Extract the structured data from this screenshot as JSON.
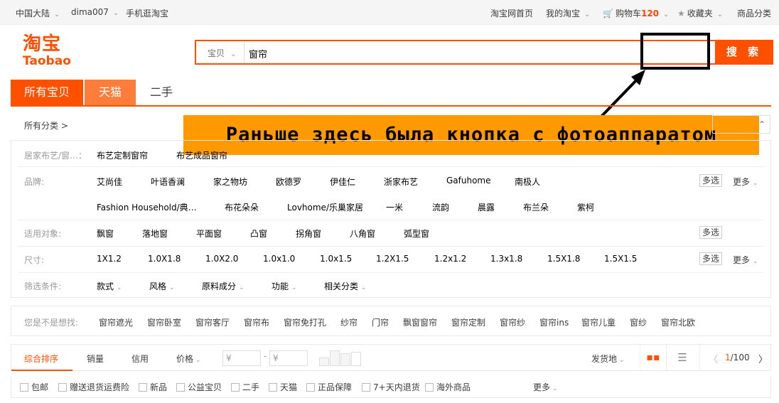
{
  "topbar": {
    "region": "中国大陆",
    "user": "dima007",
    "mobile": "手机逛淘宝",
    "home": "淘宝网首页",
    "my_taobao": "我的淘宝",
    "cart_label": "购物车",
    "cart_count": "120",
    "favorites": "收藏夹",
    "categories": "商品分类"
  },
  "logo": {
    "cn": "淘宝",
    "en": "Taobao"
  },
  "search": {
    "type": "宝贝",
    "query": "窗帘",
    "button": "搜 索"
  },
  "annotation": {
    "text": "Раньше здесь была кнопка с фотоаппаратом"
  },
  "tabs": {
    "all": "所有宝贝",
    "tmall": "天猫",
    "second": "二手"
  },
  "breadcrumb": {
    "all_categories": "所有分类 >"
  },
  "filters": {
    "category": {
      "label": "居家布艺/窗…：",
      "items": [
        "布艺定制窗帘",
        "布艺成品窗帘"
      ]
    },
    "brand": {
      "label": "品牌:",
      "row1": [
        "艾尚佳",
        "叶语香澜",
        "家之物坊",
        "欧德罗",
        "伊佳仁",
        "浙家布艺",
        "Gafuhome",
        "南极人"
      ],
      "row2": [
        "Fashion Household/典…",
        "布花朵朵",
        "Lovhome/乐巢家居",
        "一米",
        "流韵",
        "晨露",
        "布兰朵",
        "紫柯"
      ]
    },
    "target": {
      "label": "适用对象:",
      "items": [
        "飘窗",
        "落地窗",
        "平面窗",
        "凸窗",
        "拐角窗",
        "八角窗",
        "弧型窗"
      ]
    },
    "size": {
      "label": "尺寸:",
      "items": [
        "1X1.2",
        "1.0X1.8",
        "1.0X2.0",
        "1.0x1.0",
        "1.0x1.5",
        "1.2X1.5",
        "1.2x1.2",
        "1.3x1.8",
        "1.5X1.8",
        "1.5X1.5"
      ]
    },
    "conditions": {
      "label": "筛选条件:",
      "items": [
        "款式",
        "风格",
        "原料成分",
        "功能",
        "相关分类"
      ]
    },
    "multi": "多选",
    "more": "更多"
  },
  "suggest": {
    "label": "您是不是想找:",
    "items": [
      "窗帘遮光",
      "窗帘卧室",
      "窗帘客厅",
      "窗帘布",
      "窗帘免打孔",
      "纱帘",
      "门帘",
      "飘窗窗帘",
      "窗帘定制",
      "窗帘纱",
      "窗帘ins",
      "窗帘儿童",
      "窗纱",
      "窗帘北欧"
    ]
  },
  "sortbar": {
    "default": "综合排序",
    "sales": "销量",
    "credit": "信用",
    "price": "价格",
    "price_from": "¥",
    "price_to": "¥",
    "ship_from": "发货地",
    "page_current": "1",
    "page_total": "/100"
  },
  "checks": {
    "items": [
      "包邮",
      "赠送退货运费险",
      "新品",
      "公益宝贝",
      "二手",
      "天猫",
      "正品保障",
      "7+天内退货",
      "海外商品"
    ],
    "more": "更多"
  }
}
